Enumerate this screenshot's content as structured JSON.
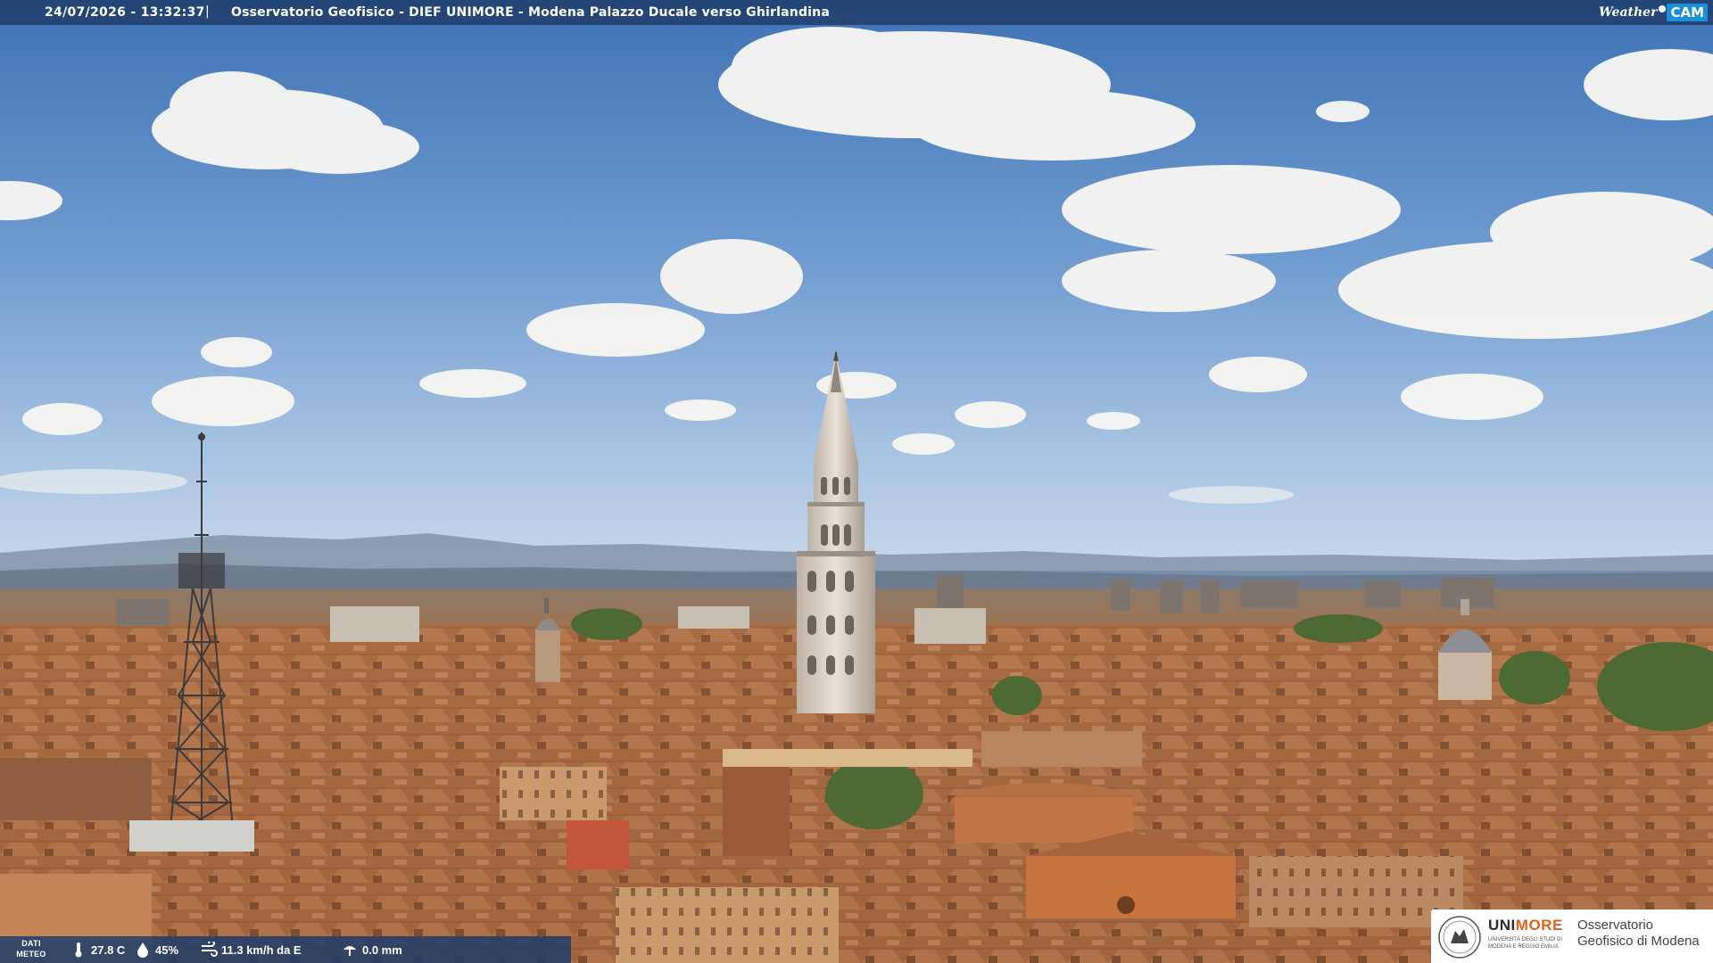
{
  "header": {
    "timestamp": "24/07/2026 - 13:32:37",
    "separator": "|",
    "title": "Osservatorio Geofisico - DIEF UNIMORE - Modena Palazzo Ducale verso Ghirlandina",
    "logo_weather": "Weather",
    "logo_cam": "CAM"
  },
  "weather": {
    "label": "DATI METEO",
    "temperature": "27.8 C",
    "humidity": "45%",
    "wind": "11.3 km/h da E",
    "rain": "0.0 mm",
    "icons": [
      "thermometer-icon",
      "humidity-drop-icon",
      "wind-icon",
      "rain-gauge-icon"
    ]
  },
  "branding": {
    "uni_prefix": "UNI",
    "uni_suffix": "MORE",
    "uni_subtitle": "Università degli Studi di Modena e Reggio Emilia",
    "observatory": "Osservatorio Geofisico di Modena"
  },
  "colors": {
    "bar": "#1f3c68",
    "accent_orange": "#e0621f",
    "sky_top": "#4a7dbd",
    "roofs": "#b8754d"
  }
}
